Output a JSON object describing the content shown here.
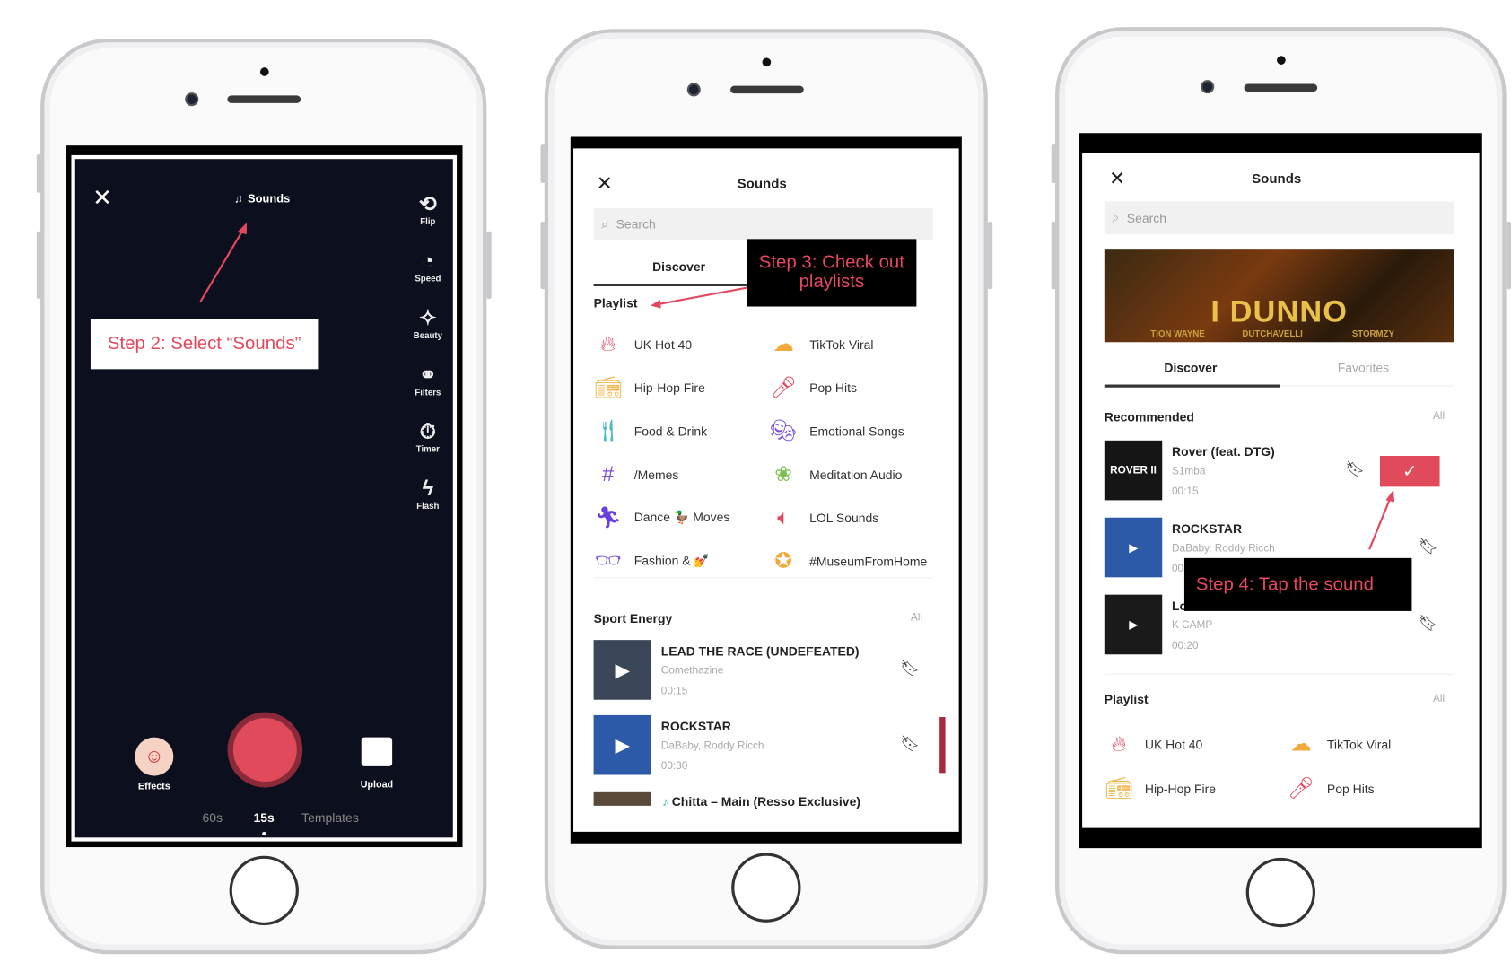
{
  "phone1": {
    "top_label": "Sounds",
    "callout": "Step 2: Select “Sounds”",
    "side_tools": [
      {
        "icon": "flip-icon",
        "glyph": "⟲",
        "label": "Flip"
      },
      {
        "icon": "speed-icon",
        "glyph": "◔",
        "label": "Speed"
      },
      {
        "icon": "beauty-icon",
        "glyph": "✧",
        "label": "Beauty"
      },
      {
        "icon": "filters-icon",
        "glyph": "⚭",
        "label": "Filters"
      },
      {
        "icon": "timer-icon",
        "glyph": "⏱",
        "label": "Timer"
      },
      {
        "icon": "flash-icon",
        "glyph": "ϟ",
        "label": "Flash"
      }
    ],
    "effects_label": "Effects",
    "upload_label": "Upload",
    "modes": [
      "60s",
      "15s",
      "Templates"
    ],
    "selected_mode": "15s",
    "record_color": "#e04a5a"
  },
  "phone2": {
    "title": "Sounds",
    "search_placeholder": "Search",
    "tab": "Discover",
    "callout": "Step 3: Check out playlists",
    "playlist_header": "Playlist",
    "playlists": [
      {
        "label": "UK Hot 40",
        "icon": "flame-icon",
        "glyph": "🔥︎",
        "color": "#e5475e"
      },
      {
        "label": "TikTok Viral",
        "icon": "cloud-music-icon",
        "glyph": "☁",
        "color": "#f0a93a"
      },
      {
        "label": "Hip-Hop Fire",
        "icon": "boombox-icon",
        "glyph": "📻︎",
        "color": "#f0b54a"
      },
      {
        "label": "Pop Hits",
        "icon": "microphone-icon",
        "glyph": "🎤︎",
        "color": "#e5475e"
      },
      {
        "label": "Food & Drink",
        "icon": "cutlery-icon",
        "glyph": "🍴︎",
        "color": "#4cb8d0"
      },
      {
        "label": "Emotional Songs",
        "icon": "masks-icon",
        "glyph": "🎭︎",
        "color": "#7a4fe0"
      },
      {
        "label": "/Memes",
        "icon": "hashtag-icon",
        "glyph": "#",
        "color": "#7a4fe0"
      },
      {
        "label": "Meditation Audio",
        "icon": "lotus-icon",
        "glyph": "❀",
        "color": "#7cc150"
      },
      {
        "label": "Dance 🦆 Moves",
        "icon": "dancer-icon",
        "glyph": "🏃︎",
        "color": "#6a3fe0"
      },
      {
        "label": "LOL Sounds",
        "icon": "speaker-icon",
        "glyph": "🔈︎",
        "color": "#e5475e"
      },
      {
        "label": "Fashion & 💅",
        "icon": "glasses-icon",
        "glyph": "👓︎",
        "color": "#7a4fe0"
      },
      {
        "label": "#MuseumFromHome",
        "icon": "badge-icon",
        "glyph": "✪",
        "color": "#f0a93a"
      }
    ],
    "sport_header": "Sport Energy",
    "sport_all": "All",
    "tracks": [
      {
        "title": "LEAD THE RACE (UNDEFEATED)",
        "artist": "Comethazine",
        "duration": "00:15",
        "thumb": "#3b4658"
      },
      {
        "title": "ROCKSTAR",
        "artist": "DaBaby, Roddy Ricch",
        "duration": "00:30",
        "thumb": "#2c5aa8"
      }
    ],
    "partial_track": "Chitta – Main (Resso Exclusive)"
  },
  "phone3": {
    "title": "Sounds",
    "search_placeholder": "Search",
    "banner": {
      "title": "I DUNNO",
      "artists": [
        "TION WAYNE",
        "DUTCHAVELLI",
        "STORMZY"
      ]
    },
    "tabs": [
      "Discover",
      "Favorites"
    ],
    "recommended_header": "Recommended",
    "recommended_all": "All",
    "tracks": [
      {
        "title": "Rover (feat. DTG)",
        "artist": "S1mba",
        "duration": "00:15",
        "thumb": "#151515",
        "thumb_text": "ROVER II"
      },
      {
        "title": "ROCKSTAR",
        "artist": "DaBaby, Roddy Ricch",
        "duration": "00:30",
        "thumb": "#2c5aa8",
        "thumb_text": "▶"
      },
      {
        "title": "Lo",
        "artist": "K CAMP",
        "duration": "00:20",
        "thumb": "#1a1a1a",
        "thumb_text": "▶"
      }
    ],
    "callout": "Step 4: Tap the sound",
    "playlist_header": "Playlist",
    "playlist_all": "All",
    "playlists": [
      {
        "label": "UK Hot 40",
        "icon": "flame-icon",
        "glyph": "🔥︎",
        "color": "#e5475e"
      },
      {
        "label": "TikTok Viral",
        "icon": "cloud-music-icon",
        "glyph": "☁",
        "color": "#f0a93a"
      },
      {
        "label": "Hip-Hop Fire",
        "icon": "boombox-icon",
        "glyph": "📻︎",
        "color": "#f0b54a"
      },
      {
        "label": "Pop Hits",
        "icon": "microphone-icon",
        "glyph": "🎤︎",
        "color": "#e5475e"
      }
    ],
    "accent": "#e04a5a"
  }
}
